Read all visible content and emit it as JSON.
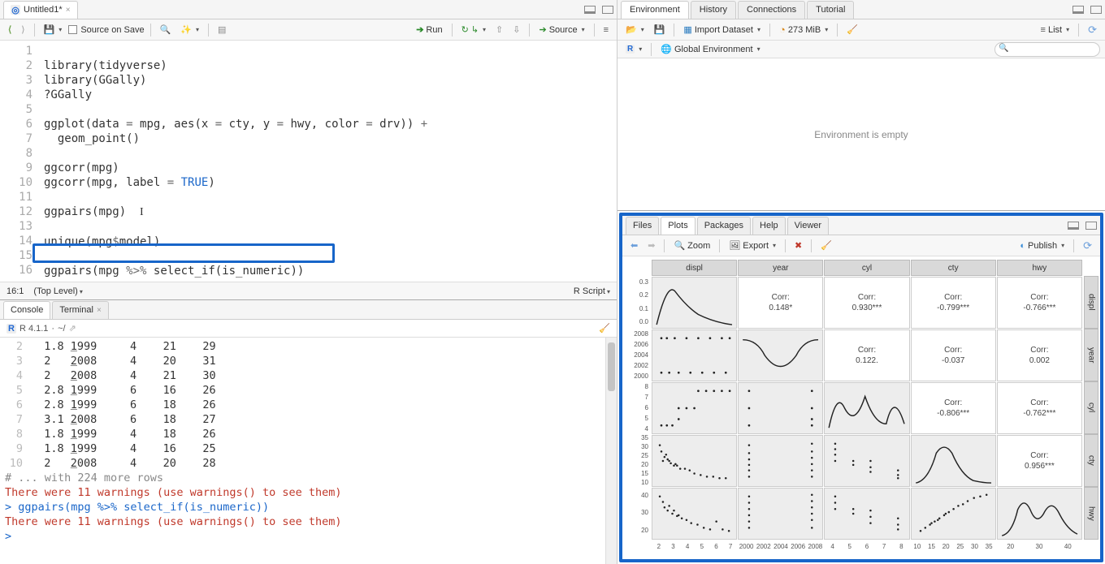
{
  "source": {
    "tab_title": "Untitled1*",
    "source_on_save": "Source on Save",
    "run": "Run",
    "source_btn": "Source",
    "lines": [
      "library(tidyverse)",
      "library(GGally)",
      "?GGally",
      "",
      "ggplot(data = mpg, aes(x = cty, y = hwy, color = drv)) +",
      "  geom_point()",
      "",
      "ggcorr(mpg)",
      "ggcorr(mpg, label = TRUE)",
      "",
      "ggpairs(mpg)",
      "",
      "unique(mpg$model)",
      "",
      "ggpairs(mpg %>% select_if(is_numeric))",
      ""
    ],
    "cursor_pos": "16:1",
    "scope": "(Top Level)",
    "lang": "R Script"
  },
  "console": {
    "tab_console": "Console",
    "tab_terminal": "Terminal",
    "version": "R 4.1.1",
    "path": "~/",
    "rows": [
      {
        "n": "2",
        "cols": [
          "1.8",
          "1999",
          "4",
          "21",
          "29"
        ]
      },
      {
        "n": "3",
        "cols": [
          "2  ",
          "2008",
          "4",
          "20",
          "31"
        ]
      },
      {
        "n": "4",
        "cols": [
          "2  ",
          "2008",
          "4",
          "21",
          "30"
        ]
      },
      {
        "n": "5",
        "cols": [
          "2.8",
          "1999",
          "6",
          "16",
          "26"
        ]
      },
      {
        "n": "6",
        "cols": [
          "2.8",
          "1999",
          "6",
          "18",
          "26"
        ]
      },
      {
        "n": "7",
        "cols": [
          "3.1",
          "2008",
          "6",
          "18",
          "27"
        ]
      },
      {
        "n": "8",
        "cols": [
          "1.8",
          "1999",
          "4",
          "18",
          "26"
        ]
      },
      {
        "n": "9",
        "cols": [
          "1.8",
          "1999",
          "4",
          "16",
          "25"
        ]
      },
      {
        "n": "10",
        "cols": [
          "2  ",
          "2008",
          "4",
          "20",
          "28"
        ]
      }
    ],
    "more": "# ... with 224 more rows",
    "warn": "There were 11 warnings (use warnings() to see them)",
    "cmd": "> ggpairs(mpg %>% select_if(is_numeric))",
    "prompt": "> "
  },
  "env": {
    "tabs": [
      "Environment",
      "History",
      "Connections",
      "Tutorial"
    ],
    "import": "Import Dataset",
    "memory": "273 MiB",
    "list": "List",
    "scope_r": "R",
    "scope_global": "Global Environment",
    "empty": "Environment is empty"
  },
  "plots": {
    "tabs": [
      "Files",
      "Plots",
      "Packages",
      "Help",
      "Viewer"
    ],
    "zoom": "Zoom",
    "export": "Export",
    "publish": "Publish"
  },
  "chart_data": {
    "type": "pairs-matrix",
    "variables": [
      "displ",
      "year",
      "cyl",
      "cty",
      "hwy"
    ],
    "upper_corr": {
      "displ_year": {
        "label": "Corr:",
        "value": "0.148*"
      },
      "displ_cyl": {
        "label": "Corr:",
        "value": "0.930***"
      },
      "displ_cty": {
        "label": "Corr:",
        "value": "-0.799***"
      },
      "displ_hwy": {
        "label": "Corr:",
        "value": "-0.766***"
      },
      "year_cyl": {
        "label": "Corr:",
        "value": "0.122."
      },
      "year_cty": {
        "label": "Corr:",
        "value": "-0.037"
      },
      "year_hwy": {
        "label": "Corr:",
        "value": "0.002"
      },
      "cyl_cty": {
        "label": "Corr:",
        "value": "-0.806***"
      },
      "cyl_hwy": {
        "label": "Corr:",
        "value": "-0.762***"
      },
      "cty_hwy": {
        "label": "Corr:",
        "value": "0.956***"
      }
    },
    "y_ticks": {
      "displ": [
        "0.3",
        "0.2",
        "0.1",
        "0.0"
      ],
      "year": [
        "2008",
        "2006",
        "2004",
        "2002",
        "2000"
      ],
      "cyl": [
        "8",
        "7",
        "6",
        "5",
        "4"
      ],
      "cty": [
        "35",
        "30",
        "25",
        "20",
        "15",
        "10"
      ],
      "hwy": [
        "40",
        "30",
        "20"
      ]
    },
    "x_ticks": {
      "displ": [
        "2",
        "3",
        "4",
        "5",
        "6",
        "7"
      ],
      "year": [
        "2000",
        "2002",
        "2004",
        "2006",
        "2008"
      ],
      "cyl": [
        "4",
        "5",
        "6",
        "7",
        "8"
      ],
      "cty": [
        "10",
        "15",
        "20",
        "25",
        "30",
        "35"
      ],
      "hwy": [
        "20",
        "30",
        "40"
      ]
    }
  }
}
